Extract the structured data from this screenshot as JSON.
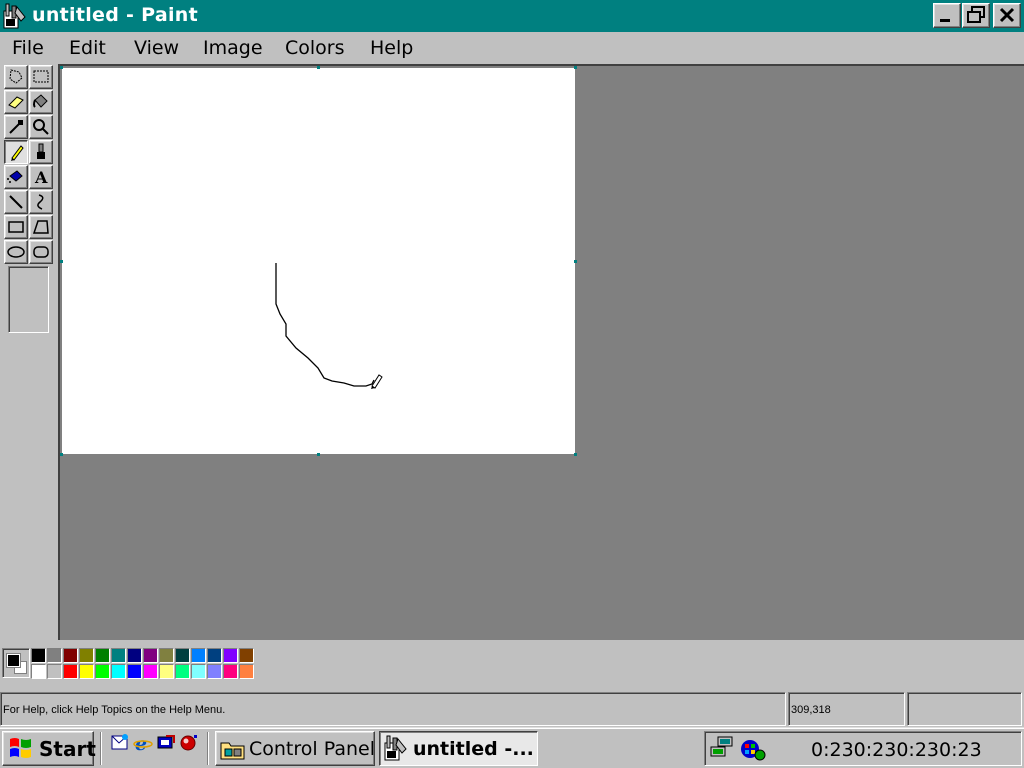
{
  "window": {
    "title": "untitled - Paint",
    "controls": {
      "minimize": "minimize",
      "maximize": "restore",
      "close": "close"
    }
  },
  "menu": [
    "File",
    "Edit",
    "View",
    "Image",
    "Colors",
    "Help"
  ],
  "toolbox": {
    "tools": [
      {
        "name": "free-form-select",
        "icon": "free-select-icon"
      },
      {
        "name": "select",
        "icon": "rect-select-icon"
      },
      {
        "name": "eraser",
        "icon": "eraser-icon"
      },
      {
        "name": "fill-with-color",
        "icon": "fill-bucket-icon"
      },
      {
        "name": "pick-color",
        "icon": "eyedropper-icon"
      },
      {
        "name": "magnifier",
        "icon": "magnifier-icon"
      },
      {
        "name": "pencil",
        "icon": "pencil-icon",
        "active": true
      },
      {
        "name": "brush",
        "icon": "brush-icon"
      },
      {
        "name": "airbrush",
        "icon": "airbrush-icon"
      },
      {
        "name": "text",
        "icon": "text-icon",
        "glyph": "A"
      },
      {
        "name": "line",
        "icon": "line-icon"
      },
      {
        "name": "curve",
        "icon": "curve-icon"
      },
      {
        "name": "rectangle",
        "icon": "rectangle-icon"
      },
      {
        "name": "polygon",
        "icon": "polygon-icon"
      },
      {
        "name": "ellipse",
        "icon": "ellipse-icon"
      },
      {
        "name": "rounded-rectangle",
        "icon": "rounded-rect-icon"
      }
    ]
  },
  "colors": {
    "accent_titlebar": "#008080",
    "workspace": "#808080",
    "foreground": "#000000",
    "background": "#ffffff",
    "palette": [
      "#000000",
      "#808080",
      "#800000",
      "#808000",
      "#008000",
      "#008080",
      "#000080",
      "#800080",
      "#808040",
      "#004040",
      "#0080ff",
      "#004080",
      "#8000ff",
      "#804000",
      "#ffffff",
      "#c0c0c0",
      "#ff0000",
      "#ffff00",
      "#00ff00",
      "#00ffff",
      "#0000ff",
      "#ff00ff",
      "#ffff80",
      "#00ff80",
      "#80ffff",
      "#8080ff",
      "#ff0080",
      "#ff8040"
    ]
  },
  "status": {
    "help_text": "For Help, click Help Topics on the Help Menu.",
    "coordinates": "309,318",
    "size": ""
  },
  "taskbar": {
    "start_label": "Start",
    "quick_launch": [
      "outlook-express-icon",
      "internet-explorer-icon",
      "show-desktop-icon",
      "channels-icon"
    ],
    "tasks": [
      {
        "label": "Control Panel",
        "icon": "control-panel-icon",
        "active": false
      },
      {
        "label": "untitled -...",
        "icon": "paint-icon",
        "active": true
      }
    ],
    "tray_icons": [
      "network-icon",
      "windows-update-icon"
    ],
    "clock": "0:230:230:230:23"
  }
}
